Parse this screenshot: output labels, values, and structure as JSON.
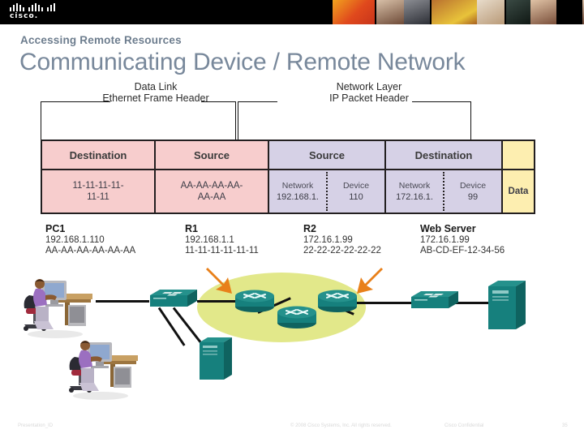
{
  "brand": {
    "logo_name": "cisco-logo",
    "wordmark": "cisco."
  },
  "header": {
    "eyebrow": "Accessing Remote Resources",
    "title": "Communicating Device / Remote Network",
    "accent_color": "#78889b",
    "bar_color": "#000000"
  },
  "brackets": {
    "left": {
      "line1": "Data Link",
      "line2": "Ethernet Frame Header"
    },
    "right": {
      "line1": "Network Layer",
      "line2": "IP Packet Header"
    }
  },
  "frame_table": {
    "headers": [
      "Destination",
      "Source",
      "Source",
      "Destination",
      "Data"
    ],
    "ethernet": {
      "destination_mac": "11-11-11-11-11-11",
      "destination_mac_l1": "11-11-11-11-",
      "destination_mac_l2": "11-11",
      "source_mac": "AA-AA-AA-AA-AA-AA",
      "source_mac_l1": "AA-AA-AA-AA-",
      "source_mac_l2": "AA-AA"
    },
    "ip": {
      "source": {
        "network_label": "Network",
        "network_value": "192.168.1.",
        "device_label": "Device",
        "device_value": "110"
      },
      "destination": {
        "network_label": "Network",
        "network_value": "172.16.1.",
        "device_label": "Device",
        "device_value": "99"
      }
    },
    "data_label": "Data",
    "colors": {
      "ethernet_fill": "#f7cdcd",
      "ip_fill": "#d6d1e6",
      "data_fill": "#fdeeb0",
      "border": "#231f20"
    }
  },
  "devices": [
    {
      "name": "PC1",
      "ip": "192.168.1.110",
      "mac": "AA-AA-AA-AA-AA-AA"
    },
    {
      "name": "R1",
      "ip": "192.168.1.1",
      "mac": "11-11-11-11-11-11"
    },
    {
      "name": "R2",
      "ip": "172.16.1.99",
      "mac": "22-22-22-22-22-22"
    },
    {
      "name": "Web Server",
      "ip": "172.16.1.99",
      "mac": "AB-CD-EF-12-34-56"
    }
  ],
  "topology": {
    "cloud_color": "#e2e88a",
    "device_color": "#16807d",
    "arrow_color": "#e8801a",
    "nodes": [
      "workstation-top",
      "workstation-bottom",
      "switch-left",
      "server-left",
      "router-1",
      "router-2",
      "router-3",
      "switch-right",
      "web-server"
    ]
  },
  "footer": {
    "presentation_id": "Presentation_ID",
    "copyright": "© 2008 Cisco Systems, Inc. All rights reserved.",
    "confidential": "Cisco Confidential",
    "page": "35"
  }
}
